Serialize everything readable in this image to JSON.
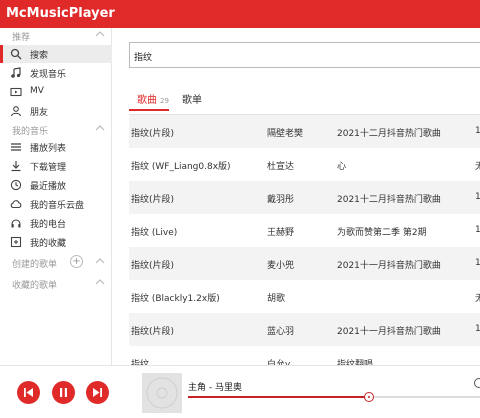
{
  "app": {
    "title": "McMusicPlayer"
  },
  "sidebar": {
    "recommend": {
      "label": "推荐",
      "items": [
        {
          "label": "搜索",
          "icon": "search-icon",
          "active": true
        },
        {
          "label": "发现音乐",
          "icon": "music-note-icon"
        },
        {
          "label": "MV",
          "icon": "video-icon"
        },
        {
          "label": "朋友",
          "icon": "user-icon"
        }
      ]
    },
    "my_music": {
      "label": "我的音乐",
      "items": [
        {
          "label": "播放列表",
          "icon": "playlist-icon"
        },
        {
          "label": "下载管理",
          "icon": "download-icon"
        },
        {
          "label": "最近播放",
          "icon": "clock-icon"
        },
        {
          "label": "我的音乐云盘",
          "icon": "cloud-icon"
        },
        {
          "label": "我的电台",
          "icon": "radio-icon"
        },
        {
          "label": "我的收藏",
          "icon": "collection-icon"
        }
      ]
    },
    "created": {
      "label": "创建的歌单"
    },
    "collected": {
      "label": "收藏的歌单"
    }
  },
  "search": {
    "value": "指纹"
  },
  "tabs": {
    "songs": "歌曲",
    "songs_count": "29",
    "playlists": "歌单"
  },
  "results": [
    {
      "title": "指纹(片段)",
      "artist": "隔壁老樊",
      "album": "2021十二月抖音热门歌曲",
      "extra": "1"
    },
    {
      "title": "指纹 (WF_Liang0.8x版)",
      "artist": "杜宣达",
      "album": "心",
      "extra": "无"
    },
    {
      "title": "指纹(片段)",
      "artist": "戴羽彤",
      "album": "2021十二月抖音热门歌曲",
      "extra": "1"
    },
    {
      "title": "指纹 (Live)",
      "artist": "王赫野",
      "album": "为歌而赞第二季 第2期",
      "extra": "1"
    },
    {
      "title": "指纹(片段)",
      "artist": "麦小兜",
      "album": "2021十一月抖音热门歌曲",
      "extra": "1"
    },
    {
      "title": "指纹 (Blackly1.2x版)",
      "artist": "胡歌",
      "album": "",
      "extra": "无"
    },
    {
      "title": "指纹(片段)",
      "artist": "蓝心羽",
      "album": "2021十一月抖音热门歌曲",
      "extra": "1"
    },
    {
      "title": "指纹",
      "artist": "白允y",
      "album": "指纹翻唱",
      "extra": ""
    }
  ],
  "player": {
    "now_playing": "主角 - 马里奥",
    "progress": 0.62
  },
  "colors": {
    "accent": "#e02a2a"
  }
}
